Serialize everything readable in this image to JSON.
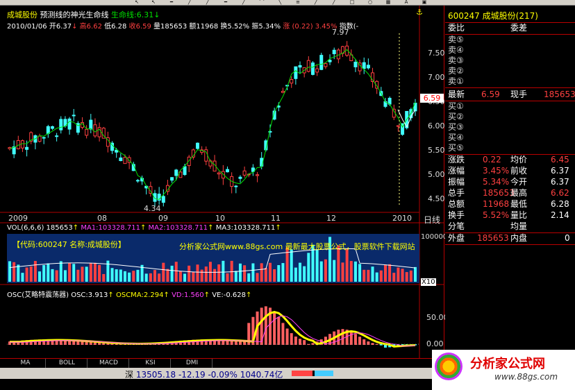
{
  "header": {
    "stock_name": "成城股份",
    "indicator_name": "预测线的神光生命线",
    "life_line_label": "生命线:6.31",
    "date": "2010/01/06",
    "open": "开6.37",
    "high": "高6.62",
    "low": "低6.28",
    "close": "收6.59",
    "volume": "量185653",
    "amount": "额11968",
    "turnover": "换5.52%",
    "amplitude": "振5.34%",
    "change": "涨 (0.22) 3.45%",
    "index_label": "指数(-"
  },
  "price_axis": [
    "7.50",
    "7.00",
    "6.50",
    "6.00",
    "5.50",
    "5.00",
    "4.50"
  ],
  "price_labels": {
    "high_mark": "7.97",
    "low_mark": "4.34",
    "current": "6.59"
  },
  "x_axis": [
    "2009",
    "08",
    "09",
    "10",
    "11",
    "12",
    "2010"
  ],
  "period_label": "日线",
  "volume_panel": {
    "title": "VOL(6,6,6)",
    "vol": "185653",
    "ma1": "MA1:103328.711",
    "ma2": "MA2:103328.711",
    "ma3": "MA3:103328.711",
    "axis_top": "100000",
    "axis_unit": "X10",
    "banner_left": "【代码:600247 名称:成城股份】",
    "banner_right": "分析家公式网www.88gs.com 最新最大股票公式，股票软件下载网站"
  },
  "osc_panel": {
    "title": "OSC(艾略特震荡器)",
    "osc": "OSC:3.913",
    "oscma": "OSCMA:2.294",
    "vd": "VD:1.560",
    "ve": "VE:-0.628",
    "axis": [
      "50.00",
      "0.00"
    ]
  },
  "tabs": [
    "MA",
    "BOLL",
    "MACD",
    "KSI",
    "DMI"
  ],
  "status": {
    "market": "深",
    "index": "13505.18",
    "change": "-12.19",
    "pct": "-0.09%",
    "amount": "1040.74亿"
  },
  "quote": {
    "code": "600247",
    "name": "成城股份",
    "count": "(217)",
    "weibi_label": "委比",
    "weicha_label": "委差",
    "sells": [
      "卖⑤",
      "卖④",
      "卖③",
      "卖②",
      "卖①"
    ],
    "latest_label": "最新",
    "latest": "6.59",
    "xianshou_label": "现手",
    "xianshou": "185653",
    "buys": [
      "买①",
      "买②",
      "买③",
      "买④",
      "买⑤"
    ],
    "rows": [
      {
        "l1": "涨跌",
        "v1": "0.22",
        "l2": "均价",
        "v2": "6.45"
      },
      {
        "l1": "涨幅",
        "v1": "3.45%",
        "l2": "前收",
        "v2": "6.37"
      },
      {
        "l1": "振幅",
        "v1": "5.34%",
        "l2": "今开",
        "v2": "6.37"
      },
      {
        "l1": "总手",
        "v1": "185653",
        "l2": "最高",
        "v2": "6.62"
      },
      {
        "l1": "总额",
        "v1": "11968",
        "l2": "最低",
        "v2": "6.28"
      },
      {
        "l1": "换手",
        "v1": "5.52%",
        "l2": "量比",
        "v2": "2.14"
      }
    ],
    "fenbi_label": "分笔",
    "junliang_label": "均量",
    "waipan_label": "外盘",
    "waipan": "185653",
    "neipan_label": "内盘",
    "neipan": "0"
  },
  "logo": {
    "name": "分析家公式网",
    "url": "www.88gs.com"
  },
  "colors": {
    "up": "#ff4040",
    "down": "#40ffff",
    "ma": "#00e000",
    "panel_border": "#b00000",
    "volume_bg": "#0a2a6a"
  }
}
